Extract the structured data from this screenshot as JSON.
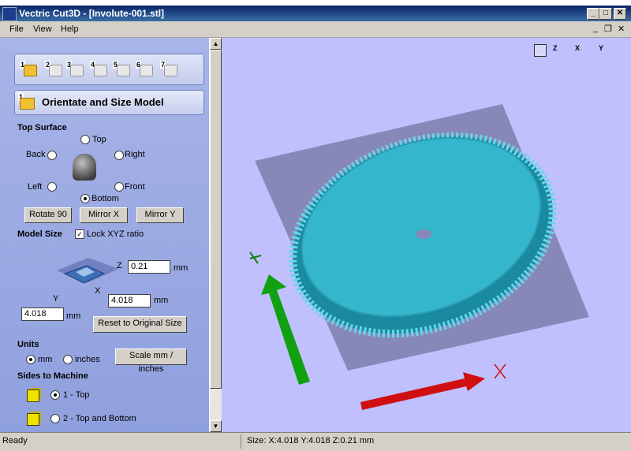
{
  "window": {
    "title": "Vectric Cut3D - [Involute-001.stl]",
    "controls": {
      "minimize": "_",
      "maximize": "□",
      "close": "✕"
    }
  },
  "menu": {
    "items": [
      "File",
      "View",
      "Help"
    ],
    "mdi_controls": {
      "minimize": "_",
      "restore": "❐",
      "close": "✕"
    }
  },
  "steps": [
    "1",
    "2",
    "3",
    "4",
    "5",
    "6",
    "7"
  ],
  "panel": {
    "step_number": "1",
    "heading": "Orientate and Size Model",
    "top_surface": {
      "label": "Top Surface",
      "options": {
        "top": "Top",
        "back": "Back",
        "right": "Right",
        "left": "Left",
        "front": "Front",
        "bottom": "Bottom"
      },
      "selected": "Bottom"
    },
    "buttons": {
      "rotate": "Rotate 90",
      "mirror_x": "Mirror X",
      "mirror_y": "Mirror Y",
      "reset": "Reset to Original Size",
      "scale": "Scale mm / inches"
    },
    "model_size": {
      "label": "Model Size",
      "lock_label": "Lock XYZ ratio",
      "lock_checked": true,
      "z_axis": "Z",
      "x_axis": "X",
      "y_axis": "Y",
      "z_value": "0.21",
      "x_value": "4.018",
      "y_value": "4.018",
      "unit": "mm"
    },
    "units": {
      "label": "Units",
      "mm": "mm",
      "inches": "inches",
      "selected": "mm"
    },
    "sides": {
      "label": "Sides to Machine",
      "opt1": "1 - Top",
      "opt2": "2 - Top and Bottom",
      "selected": "1 - Top"
    }
  },
  "view": {
    "toolbar_icons": [
      "iso-view-icon",
      "z-view-icon",
      "x-view-icon",
      "y-view-icon"
    ],
    "axis_labels": {
      "x": "X",
      "y": "Y",
      "z": "Z"
    },
    "colors": {
      "background": "#c0c0ff",
      "plate": "#8888b8",
      "model": "#2fb0c8",
      "x_arrow": "#d01010",
      "y_arrow": "#10a010"
    }
  },
  "status": {
    "left": "Ready",
    "size": "Size: X:4.018 Y:4.018 Z:0.21 mm"
  }
}
